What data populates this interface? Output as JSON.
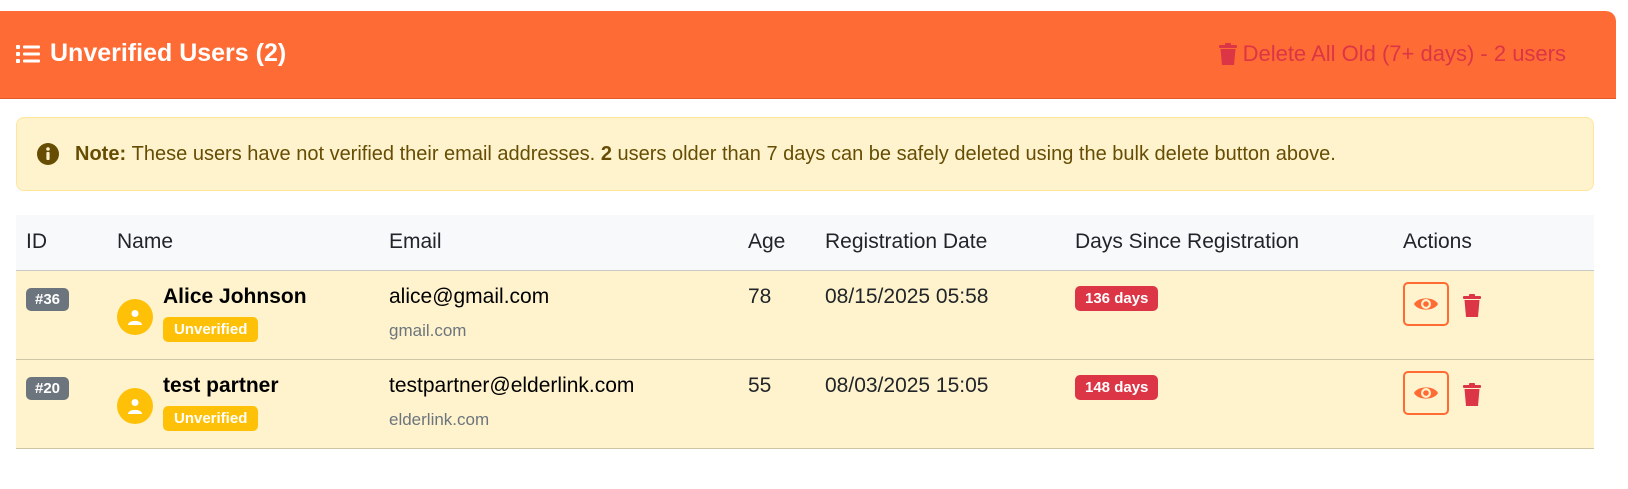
{
  "header": {
    "title": "Unverified Users (2)",
    "delete_all_label": "Delete All Old (7+ days) - 2 users",
    "accent_color": "#ff6b35",
    "danger_color": "#dc3545"
  },
  "alert": {
    "note_label": "Note:",
    "text_before": "These users have not verified their email addresses.",
    "count": "2",
    "text_after": "users older than 7 days can be safely deleted using the bulk delete button above."
  },
  "table": {
    "columns": [
      "ID",
      "Name",
      "Email",
      "Age",
      "Registration Date",
      "Days Since Registration",
      "Actions"
    ],
    "rows": [
      {
        "id": "#36",
        "name": "Alice Johnson",
        "status": "Unverified",
        "email": "alice@gmail.com",
        "domain": "gmail.com",
        "age": "78",
        "registration_date": "08/15/2025 05:58",
        "days": "136 days"
      },
      {
        "id": "#20",
        "name": "test partner",
        "status": "Unverified",
        "email": "testpartner@elderlink.com",
        "domain": "elderlink.com",
        "age": "55",
        "registration_date": "08/03/2025 15:05",
        "days": "148 days"
      }
    ]
  },
  "icons": {
    "header": "list-icon",
    "delete_all": "trash-icon",
    "alert": "info-circle-icon",
    "avatar": "user-icon",
    "view": "eye-icon",
    "delete": "trash-icon"
  }
}
